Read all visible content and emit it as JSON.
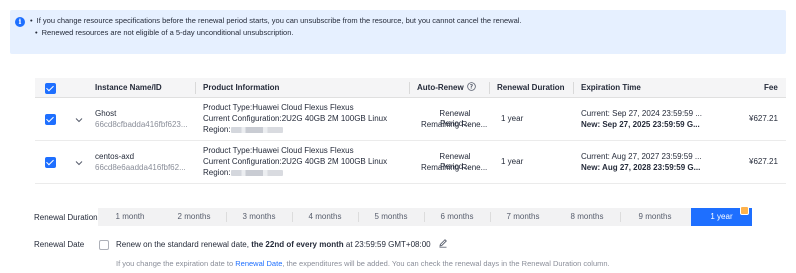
{
  "notice": {
    "line1": "If you change resource specifications before the renewal period starts, you can unsubscribe from the resource, but you cannot cancel the renewal.",
    "line2": "Renewed resources are not eligible of a 5-day unconditional unsubscription."
  },
  "table": {
    "headers": {
      "instance": "Instance Name/ID",
      "product": "Product Information",
      "auto_renew": "Auto-Renew",
      "renewal_duration": "Renewal Duration",
      "expiration": "Expiration Time",
      "fee": "Fee"
    },
    "rows": [
      {
        "name": "Ghost",
        "id": "66cd8cfbadda416fbf623...",
        "product_type": "Product Type:Huawei Cloud Flexus Flexus",
        "config": "Current Configuration:2U2G 40GB 2M 100GB Linux",
        "region_label": "Region:",
        "auto_renew_1": "Renewal Period...",
        "auto_renew_2": "Remaining Rene...",
        "duration": "1 year",
        "current_exp": "Current: Sep 27, 2024 23:59:59 ...",
        "new_exp": "New: Sep 27, 2025 23:59:59 G...",
        "fee": "¥627.21"
      },
      {
        "name": "centos-axd",
        "id": "66cd8e6aadda416fbf62...",
        "product_type": "Product Type:Huawei Cloud Flexus Flexus",
        "config": "Current Configuration:2U2G 40GB 2M 100GB Linux",
        "region_label": "Region:",
        "auto_renew_1": "Renewal Period...",
        "auto_renew_2": "Remaining Rene...",
        "duration": "1 year",
        "current_exp": "Current: Aug 27, 2027 23:59:59 ...",
        "new_exp": "New: Aug 27, 2028 23:59:59 G...",
        "fee": "¥627.21"
      }
    ]
  },
  "renewal_duration": {
    "label": "Renewal Duration",
    "options": [
      "1 month",
      "2 months",
      "3 months",
      "4 months",
      "5 months",
      "6 months",
      "7 months",
      "8 months",
      "9 months",
      "1 year"
    ],
    "selected": "1 year"
  },
  "renewal_date": {
    "label": "Renewal Date",
    "text_pre": "Renew on the standard renewal date, ",
    "text_bold": "the 22nd of every month",
    "text_post": " at 23:59:59 GMT+08:00",
    "hint_pre": "If you change the expiration date to ",
    "hint_link": "Renewal Date",
    "hint_post": ", the expenditures will be added. You can check the renewal days in the Renewal Duration column."
  },
  "colors": {
    "accent": "#1e6fff",
    "notice_bg": "#e6f0ff",
    "header_bg": "#f5f5f6"
  }
}
